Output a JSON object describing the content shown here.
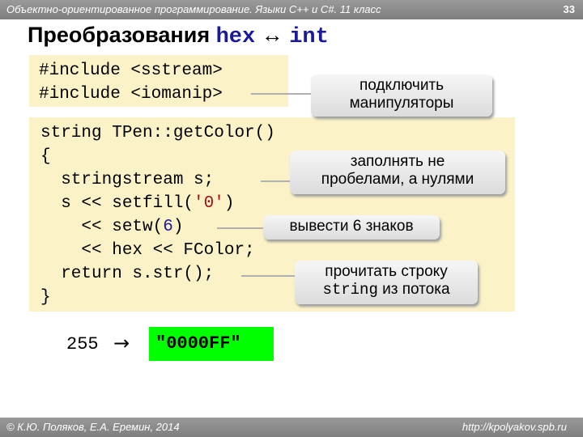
{
  "header": {
    "course": "Объектно-ориентированное программирование. Языки С++ и C#. 11 класс",
    "page_number": "33"
  },
  "slide": {
    "title_prefix": "Преобразования ",
    "title_hex": "hex",
    "title_arrow": " ↔ ",
    "title_int": "int"
  },
  "code_includes": [
    "#include <sstream>",
    "#include <iomanip>"
  ],
  "code_function": {
    "l1": "string TPen::getColor()",
    "l2": "{",
    "l3": "  stringstream s;",
    "l4_a": "  s << setfill(",
    "l4_b": "'0'",
    "l4_c": ")",
    "l5_a": "    << setw(",
    "l5_b": "6",
    "l5_c": ")",
    "l6": "    << hex << FColor;",
    "l7": "  return s.str();",
    "l8": "}"
  },
  "callouts": {
    "connect_line1": "подключить",
    "connect_line2": "манипуляторы",
    "fill_line1": "заполнять не",
    "fill_line2": "пробелами, а нулями",
    "width": "вывести 6 знаков",
    "read_line1": "прочитать строку",
    "read_mono": "string",
    "read_rest": " из потока"
  },
  "example": {
    "input": "255",
    "arrow": "→",
    "output": "\"0000FF\""
  },
  "footer": {
    "authors": "© К.Ю. Поляков, Е.А. Еремин, 2014",
    "url": "http://kpolyakov.spb.ru"
  }
}
